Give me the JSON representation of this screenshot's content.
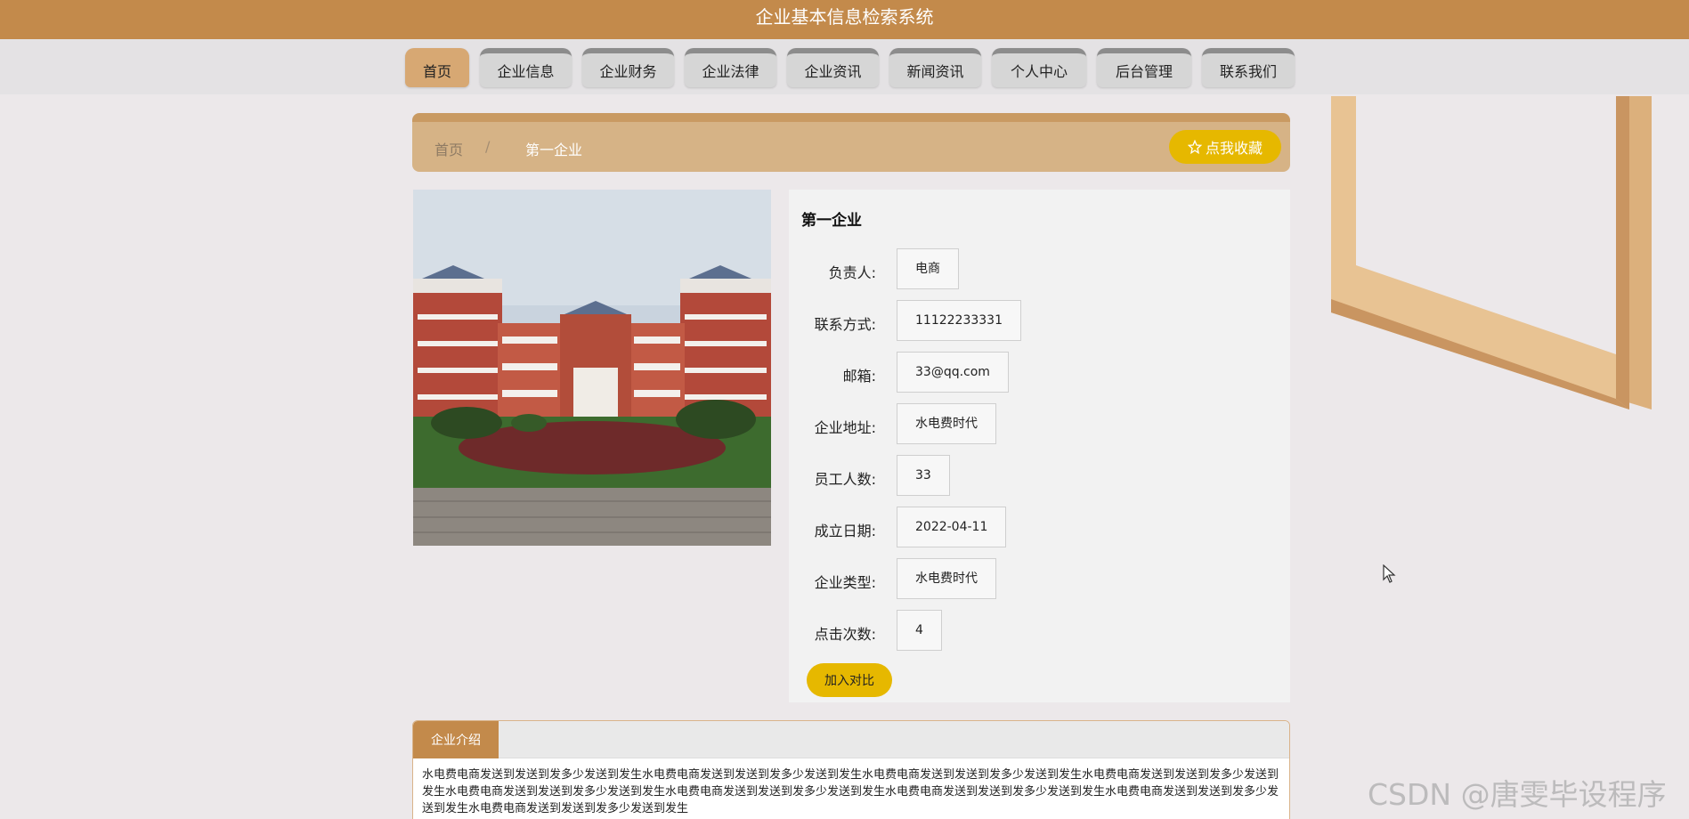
{
  "app": {
    "title": "企业基本信息检索系统"
  },
  "nav": {
    "items": [
      {
        "label": "首页",
        "active": true
      },
      {
        "label": "企业信息"
      },
      {
        "label": "企业财务"
      },
      {
        "label": "企业法律"
      },
      {
        "label": "企业资讯"
      },
      {
        "label": "新闻资讯"
      },
      {
        "label": "个人中心"
      },
      {
        "label": "后台管理"
      },
      {
        "label": "联系我们"
      }
    ]
  },
  "breadcrumb": {
    "home": "首页",
    "separator": "/",
    "current": "第一企业"
  },
  "favorite": {
    "icon": "star-icon",
    "label": "点我收藏"
  },
  "company": {
    "name": "第一企业",
    "fields": [
      {
        "label": "负责人:",
        "value": "电商"
      },
      {
        "label": "联系方式:",
        "value": "11122233331"
      },
      {
        "label": "邮箱:",
        "value": "33@qq.com"
      },
      {
        "label": "企业地址:",
        "value": "水电费时代"
      },
      {
        "label": "员工人数:",
        "value": "33"
      },
      {
        "label": "成立日期:",
        "value": "2022-04-11"
      },
      {
        "label": "企业类型:",
        "value": "水电费时代"
      },
      {
        "label": "点击次数:",
        "value": "4"
      }
    ],
    "compare_label": "加入对比"
  },
  "intro": {
    "tab": "企业介绍",
    "text": "水电费电商发送到发送到发多少发送到发生水电费电商发送到发送到发多少发送到发生水电费电商发送到发送到发多少发送到发生水电费电商发送到发送到发多少发送到发生水电费电商发送到发送到发多少发送到发生水电费电商发送到发送到发多少发送到发生水电费电商发送到发送到发多少发送到发生水电费电商发送到发送到发多少发送到发生水电费电商发送到发送到发多少发送到发生"
  },
  "watermark": "CSDN @唐雯毕设程序",
  "colors": {
    "header": "#c38a4b",
    "accent_button": "#e6b800",
    "breadcrumb_bg": "#d6b386"
  }
}
